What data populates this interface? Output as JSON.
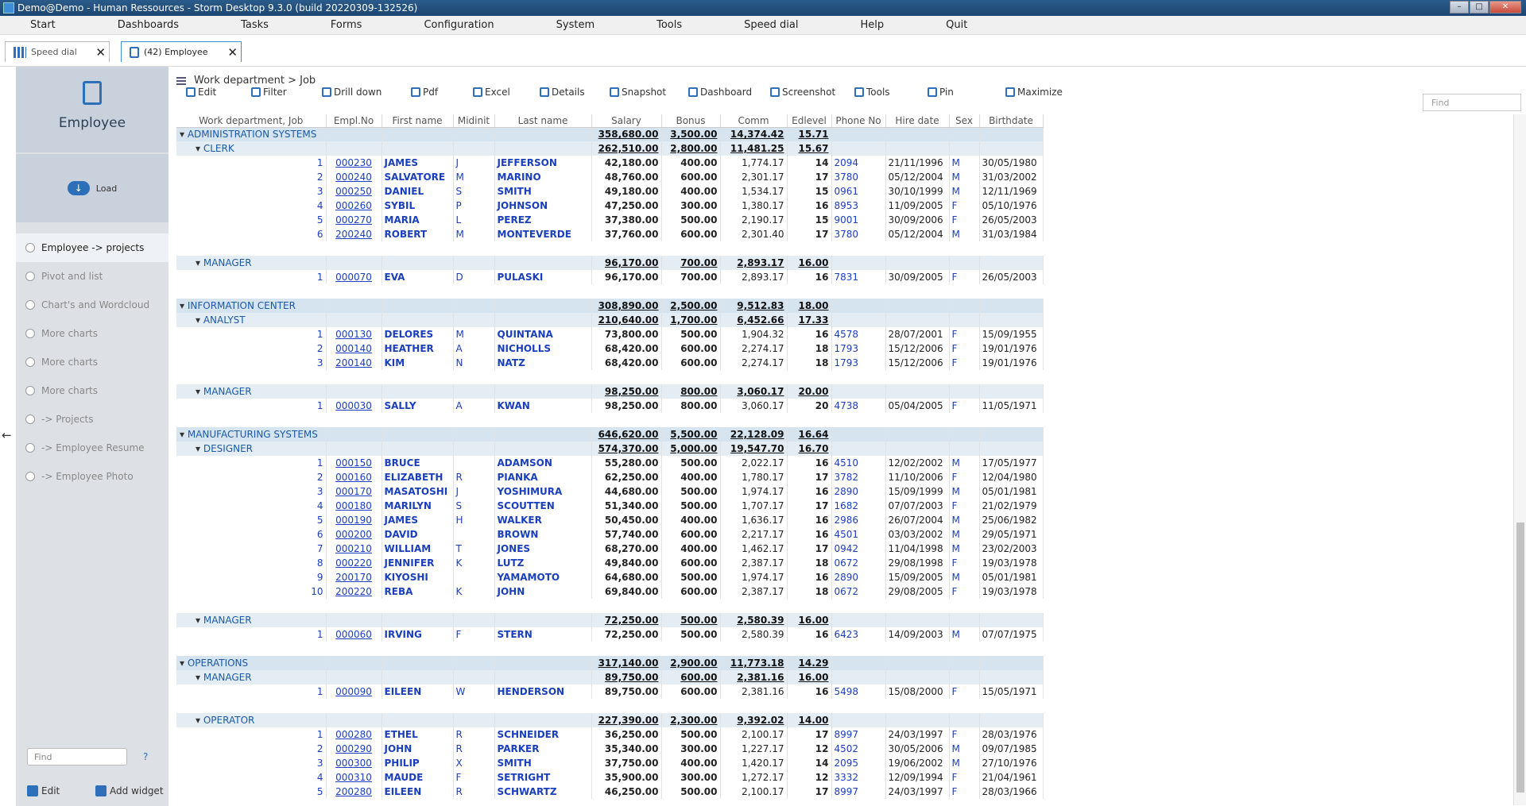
{
  "window": {
    "title": "Demo@Demo - Human Ressources - Storm Desktop 9.3.0 (build 20220309-132526)"
  },
  "menu": [
    "Start",
    "Dashboards",
    "Tasks",
    "Forms",
    "Configuration",
    "System",
    "Tools",
    "Speed dial",
    "Help",
    "Quit"
  ],
  "tabs": [
    {
      "label": "Speed dial"
    },
    {
      "label": "(42) Employee"
    }
  ],
  "sidebar": {
    "title": "Employee",
    "load": "Load",
    "items": [
      "Employee -> projects",
      "Pivot and list",
      "Chart's and Wordcloud",
      "More charts",
      "More charts",
      "More charts",
      "-> Projects",
      "-> Employee Resume",
      "-> Employee Photo"
    ],
    "find_placeholder": "Find",
    "help": "?",
    "edit": "Edit",
    "add_widget": "Add widget"
  },
  "breadcrumb": "Work department > Job",
  "toolbar": [
    "Edit",
    "Filter",
    "Drill down",
    "Pdf",
    "Excel",
    "Details",
    "Snapshot",
    "Dashboard",
    "Screenshot",
    "Tools",
    "Pin",
    "Maximize"
  ],
  "find_placeholder": "Find",
  "columns": [
    "Work department, Job",
    "Empl.No",
    "First name",
    "Midinit",
    "Last name",
    "Salary",
    "Bonus",
    "Comm",
    "Edlevel",
    "Phone No",
    "Hire date",
    "Sex",
    "Birthdate"
  ],
  "rows": [
    {
      "t": "d",
      "label": "ADMINISTRATION SYSTEMS",
      "salary": "358,680.00",
      "bonus": "3,500.00",
      "comm": "14,374.42",
      "ed": "15.71"
    },
    {
      "t": "j",
      "label": "CLERK",
      "salary": "262,510.00",
      "bonus": "2,800.00",
      "comm": "11,481.25",
      "ed": "15.67"
    },
    {
      "t": "e",
      "n": "1",
      "no": "000230",
      "fn": "JAMES",
      "mi": "J",
      "ln": "JEFFERSON",
      "salary": "42,180.00",
      "bonus": "400.00",
      "comm": "1,774.17",
      "ed": "14",
      "ph": "2094",
      "hd": "21/11/1996",
      "sx": "M",
      "bd": "30/05/1980"
    },
    {
      "t": "e",
      "n": "2",
      "no": "000240",
      "fn": "SALVATORE",
      "mi": "M",
      "ln": "MARINO",
      "salary": "48,760.00",
      "bonus": "600.00",
      "comm": "2,301.17",
      "ed": "17",
      "ph": "3780",
      "hd": "05/12/2004",
      "sx": "M",
      "bd": "31/03/2002"
    },
    {
      "t": "e",
      "n": "3",
      "no": "000250",
      "fn": "DANIEL",
      "mi": "S",
      "ln": "SMITH",
      "salary": "49,180.00",
      "bonus": "400.00",
      "comm": "1,534.17",
      "ed": "15",
      "ph": "0961",
      "hd": "30/10/1999",
      "sx": "M",
      "bd": "12/11/1969"
    },
    {
      "t": "e",
      "n": "4",
      "no": "000260",
      "fn": "SYBIL",
      "mi": "P",
      "ln": "JOHNSON",
      "salary": "47,250.00",
      "bonus": "300.00",
      "comm": "1,380.17",
      "ed": "16",
      "ph": "8953",
      "hd": "11/09/2005",
      "sx": "F",
      "bd": "05/10/1976"
    },
    {
      "t": "e",
      "n": "5",
      "no": "000270",
      "fn": "MARIA",
      "mi": "L",
      "ln": "PEREZ",
      "salary": "37,380.00",
      "bonus": "500.00",
      "comm": "2,190.17",
      "ed": "15",
      "ph": "9001",
      "hd": "30/09/2006",
      "sx": "F",
      "bd": "26/05/2003"
    },
    {
      "t": "e",
      "n": "6",
      "no": "200240",
      "fn": "ROBERT",
      "mi": "M",
      "ln": "MONTEVERDE",
      "salary": "37,760.00",
      "bonus": "600.00",
      "comm": "2,301.40",
      "ed": "17",
      "ph": "3780",
      "hd": "05/12/2004",
      "sx": "M",
      "bd": "31/03/1984"
    },
    {
      "t": "g"
    },
    {
      "t": "j",
      "label": "MANAGER",
      "salary": "96,170.00",
      "bonus": "700.00",
      "comm": "2,893.17",
      "ed": "16.00"
    },
    {
      "t": "e",
      "n": "1",
      "no": "000070",
      "fn": "EVA",
      "mi": "D",
      "ln": "PULASKI",
      "salary": "96,170.00",
      "bonus": "700.00",
      "comm": "2,893.17",
      "ed": "16",
      "ph": "7831",
      "hd": "30/09/2005",
      "sx": "F",
      "bd": "26/05/2003"
    },
    {
      "t": "g"
    },
    {
      "t": "d",
      "label": "INFORMATION CENTER",
      "salary": "308,890.00",
      "bonus": "2,500.00",
      "comm": "9,512.83",
      "ed": "18.00"
    },
    {
      "t": "j",
      "label": "ANALYST",
      "salary": "210,640.00",
      "bonus": "1,700.00",
      "comm": "6,452.66",
      "ed": "17.33"
    },
    {
      "t": "e",
      "n": "1",
      "no": "000130",
      "fn": "DELORES",
      "mi": "M",
      "ln": "QUINTANA",
      "salary": "73,800.00",
      "bonus": "500.00",
      "comm": "1,904.32",
      "ed": "16",
      "ph": "4578",
      "hd": "28/07/2001",
      "sx": "F",
      "bd": "15/09/1955"
    },
    {
      "t": "e",
      "n": "2",
      "no": "000140",
      "fn": "HEATHER",
      "mi": "A",
      "ln": "NICHOLLS",
      "salary": "68,420.00",
      "bonus": "600.00",
      "comm": "2,274.17",
      "ed": "18",
      "ph": "1793",
      "hd": "15/12/2006",
      "sx": "F",
      "bd": "19/01/1976"
    },
    {
      "t": "e",
      "n": "3",
      "no": "200140",
      "fn": "KIM",
      "mi": "N",
      "ln": "NATZ",
      "salary": "68,420.00",
      "bonus": "600.00",
      "comm": "2,274.17",
      "ed": "18",
      "ph": "1793",
      "hd": "15/12/2006",
      "sx": "F",
      "bd": "19/01/1976"
    },
    {
      "t": "g"
    },
    {
      "t": "j",
      "label": "MANAGER",
      "salary": "98,250.00",
      "bonus": "800.00",
      "comm": "3,060.17",
      "ed": "20.00"
    },
    {
      "t": "e",
      "n": "1",
      "no": "000030",
      "fn": "SALLY",
      "mi": "A",
      "ln": "KWAN",
      "salary": "98,250.00",
      "bonus": "800.00",
      "comm": "3,060.17",
      "ed": "20",
      "ph": "4738",
      "hd": "05/04/2005",
      "sx": "F",
      "bd": "11/05/1971"
    },
    {
      "t": "g"
    },
    {
      "t": "d",
      "label": "MANUFACTURING SYSTEMS",
      "salary": "646,620.00",
      "bonus": "5,500.00",
      "comm": "22,128.09",
      "ed": "16.64"
    },
    {
      "t": "j",
      "label": "DESIGNER",
      "salary": "574,370.00",
      "bonus": "5,000.00",
      "comm": "19,547.70",
      "ed": "16.70"
    },
    {
      "t": "e",
      "n": "1",
      "no": "000150",
      "fn": "BRUCE",
      "mi": "",
      "ln": "ADAMSON",
      "salary": "55,280.00",
      "bonus": "500.00",
      "comm": "2,022.17",
      "ed": "16",
      "ph": "4510",
      "hd": "12/02/2002",
      "sx": "M",
      "bd": "17/05/1977"
    },
    {
      "t": "e",
      "n": "2",
      "no": "000160",
      "fn": "ELIZABETH",
      "mi": "R",
      "ln": "PIANKA",
      "salary": "62,250.00",
      "bonus": "400.00",
      "comm": "1,780.17",
      "ed": "17",
      "ph": "3782",
      "hd": "11/10/2006",
      "sx": "F",
      "bd": "12/04/1980"
    },
    {
      "t": "e",
      "n": "3",
      "no": "000170",
      "fn": "MASATOSHI",
      "mi": "J",
      "ln": "YOSHIMURA",
      "salary": "44,680.00",
      "bonus": "500.00",
      "comm": "1,974.17",
      "ed": "16",
      "ph": "2890",
      "hd": "15/09/1999",
      "sx": "M",
      "bd": "05/01/1981"
    },
    {
      "t": "e",
      "n": "4",
      "no": "000180",
      "fn": "MARILYN",
      "mi": "S",
      "ln": "SCOUTTEN",
      "salary": "51,340.00",
      "bonus": "500.00",
      "comm": "1,707.17",
      "ed": "17",
      "ph": "1682",
      "hd": "07/07/2003",
      "sx": "F",
      "bd": "21/02/1979"
    },
    {
      "t": "e",
      "n": "5",
      "no": "000190",
      "fn": "JAMES",
      "mi": "H",
      "ln": "WALKER",
      "salary": "50,450.00",
      "bonus": "400.00",
      "comm": "1,636.17",
      "ed": "16",
      "ph": "2986",
      "hd": "26/07/2004",
      "sx": "M",
      "bd": "25/06/1982"
    },
    {
      "t": "e",
      "n": "6",
      "no": "000200",
      "fn": "DAVID",
      "mi": "",
      "ln": "BROWN",
      "salary": "57,740.00",
      "bonus": "600.00",
      "comm": "2,217.17",
      "ed": "16",
      "ph": "4501",
      "hd": "03/03/2002",
      "sx": "M",
      "bd": "29/05/1971"
    },
    {
      "t": "e",
      "n": "7",
      "no": "000210",
      "fn": "WILLIAM",
      "mi": "T",
      "ln": "JONES",
      "salary": "68,270.00",
      "bonus": "400.00",
      "comm": "1,462.17",
      "ed": "17",
      "ph": "0942",
      "hd": "11/04/1998",
      "sx": "M",
      "bd": "23/02/2003"
    },
    {
      "t": "e",
      "n": "8",
      "no": "000220",
      "fn": "JENNIFER",
      "mi": "K",
      "ln": "LUTZ",
      "salary": "49,840.00",
      "bonus": "600.00",
      "comm": "2,387.17",
      "ed": "18",
      "ph": "0672",
      "hd": "29/08/1998",
      "sx": "F",
      "bd": "19/03/1978"
    },
    {
      "t": "e",
      "n": "9",
      "no": "200170",
      "fn": "KIYOSHI",
      "mi": "",
      "ln": "YAMAMOTO",
      "salary": "64,680.00",
      "bonus": "500.00",
      "comm": "1,974.17",
      "ed": "16",
      "ph": "2890",
      "hd": "15/09/2005",
      "sx": "M",
      "bd": "05/01/1981"
    },
    {
      "t": "e",
      "n": "10",
      "no": "200220",
      "fn": "REBA",
      "mi": "K",
      "ln": "JOHN",
      "salary": "69,840.00",
      "bonus": "600.00",
      "comm": "2,387.17",
      "ed": "18",
      "ph": "0672",
      "hd": "29/08/2005",
      "sx": "F",
      "bd": "19/03/1978"
    },
    {
      "t": "g"
    },
    {
      "t": "j",
      "label": "MANAGER",
      "salary": "72,250.00",
      "bonus": "500.00",
      "comm": "2,580.39",
      "ed": "16.00"
    },
    {
      "t": "e",
      "n": "1",
      "no": "000060",
      "fn": "IRVING",
      "mi": "F",
      "ln": "STERN",
      "salary": "72,250.00",
      "bonus": "500.00",
      "comm": "2,580.39",
      "ed": "16",
      "ph": "6423",
      "hd": "14/09/2003",
      "sx": "M",
      "bd": "07/07/1975"
    },
    {
      "t": "g"
    },
    {
      "t": "d",
      "label": "OPERATIONS",
      "salary": "317,140.00",
      "bonus": "2,900.00",
      "comm": "11,773.18",
      "ed": "14.29"
    },
    {
      "t": "j",
      "label": "MANAGER",
      "salary": "89,750.00",
      "bonus": "600.00",
      "comm": "2,381.16",
      "ed": "16.00"
    },
    {
      "t": "e",
      "n": "1",
      "no": "000090",
      "fn": "EILEEN",
      "mi": "W",
      "ln": "HENDERSON",
      "salary": "89,750.00",
      "bonus": "600.00",
      "comm": "2,381.16",
      "ed": "16",
      "ph": "5498",
      "hd": "15/08/2000",
      "sx": "F",
      "bd": "15/05/1971"
    },
    {
      "t": "g"
    },
    {
      "t": "j",
      "label": "OPERATOR",
      "salary": "227,390.00",
      "bonus": "2,300.00",
      "comm": "9,392.02",
      "ed": "14.00"
    },
    {
      "t": "e",
      "n": "1",
      "no": "000280",
      "fn": "ETHEL",
      "mi": "R",
      "ln": "SCHNEIDER",
      "salary": "36,250.00",
      "bonus": "500.00",
      "comm": "2,100.17",
      "ed": "17",
      "ph": "8997",
      "hd": "24/03/1997",
      "sx": "F",
      "bd": "28/03/1976"
    },
    {
      "t": "e",
      "n": "2",
      "no": "000290",
      "fn": "JOHN",
      "mi": "R",
      "ln": "PARKER",
      "salary": "35,340.00",
      "bonus": "300.00",
      "comm": "1,227.17",
      "ed": "12",
      "ph": "4502",
      "hd": "30/05/2006",
      "sx": "M",
      "bd": "09/07/1985"
    },
    {
      "t": "e",
      "n": "3",
      "no": "000300",
      "fn": "PHILIP",
      "mi": "X",
      "ln": "SMITH",
      "salary": "37,750.00",
      "bonus": "400.00",
      "comm": "1,420.17",
      "ed": "14",
      "ph": "2095",
      "hd": "19/06/2002",
      "sx": "M",
      "bd": "27/10/1976"
    },
    {
      "t": "e",
      "n": "4",
      "no": "000310",
      "fn": "MAUDE",
      "mi": "F",
      "ln": "SETRIGHT",
      "salary": "35,900.00",
      "bonus": "300.00",
      "comm": "1,272.17",
      "ed": "12",
      "ph": "3332",
      "hd": "12/09/1994",
      "sx": "F",
      "bd": "21/04/1961"
    },
    {
      "t": "e",
      "n": "5",
      "no": "200280",
      "fn": "EILEEN",
      "mi": "R",
      "ln": "SCHWARTZ",
      "salary": "46,250.00",
      "bonus": "500.00",
      "comm": "2,100.17",
      "ed": "17",
      "ph": "8997",
      "hd": "24/03/1997",
      "sx": "F",
      "bd": "28/03/1966"
    }
  ]
}
